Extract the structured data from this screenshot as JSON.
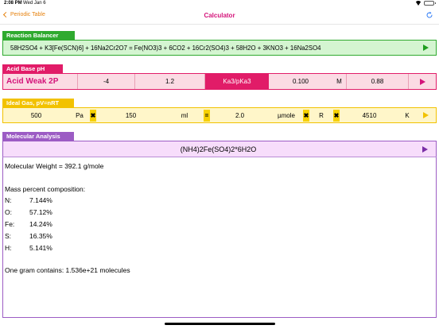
{
  "status": {
    "time": "2:08 PM",
    "date": "Wed Jan 6"
  },
  "nav": {
    "back_label": "Periodic Table",
    "title": "Calculator"
  },
  "reaction": {
    "tab_label": "Reaction Balancer",
    "equation": "58H2SO4 + K3[Fe(SCN)6] + 16Na2Cr2O7 = Fe(NO3)3 + 6CO2 + 16Cr2(SO4)3 + 58H2O + 3KNO3 + 16Na2SO4"
  },
  "acid": {
    "tab_label": "Acid Base pH",
    "type": "Acid Weak 2P",
    "value1": "-4",
    "value2": "1.2",
    "mode": "Ka3/pKa3",
    "concentration": "0.100",
    "unit": "M",
    "result": "0.88"
  },
  "gas": {
    "tab_label": "Ideal Gas, pV=nRT",
    "pressure": "500",
    "pressure_unit": "Pa",
    "op1": "✖",
    "volume": "150",
    "volume_unit": "ml",
    "op2": "=",
    "amount": "2.0",
    "amount_unit": "µmole",
    "op3": "✖",
    "r_label": "R",
    "op4": "✖",
    "temperature": "4510",
    "temperature_unit": "K"
  },
  "molecular": {
    "tab_label": "Molecular Analysis",
    "formula": "(NH4)2Fe(SO4)2*6H2O",
    "weight_line": "Molecular Weight = 392.1 g/mole",
    "composition_heading": "Mass percent composition:",
    "elements": [
      {
        "symbol": "N:",
        "percent": "7.144%"
      },
      {
        "symbol": "O:",
        "percent": "57.12%"
      },
      {
        "symbol": "Fe:",
        "percent": "14.24%"
      },
      {
        "symbol": "S:",
        "percent": "16.35%"
      },
      {
        "symbol": "H:",
        "percent": "5.141%"
      }
    ],
    "molecules_line": "One gram contains: 1.536e+21 molecules"
  },
  "colors": {
    "reaction": "#2faa2f",
    "acid": "#e11c68",
    "gas": "#f2c200",
    "molecular": "#9c5cc4",
    "title": "#d4147a",
    "back": "#e6820e"
  }
}
